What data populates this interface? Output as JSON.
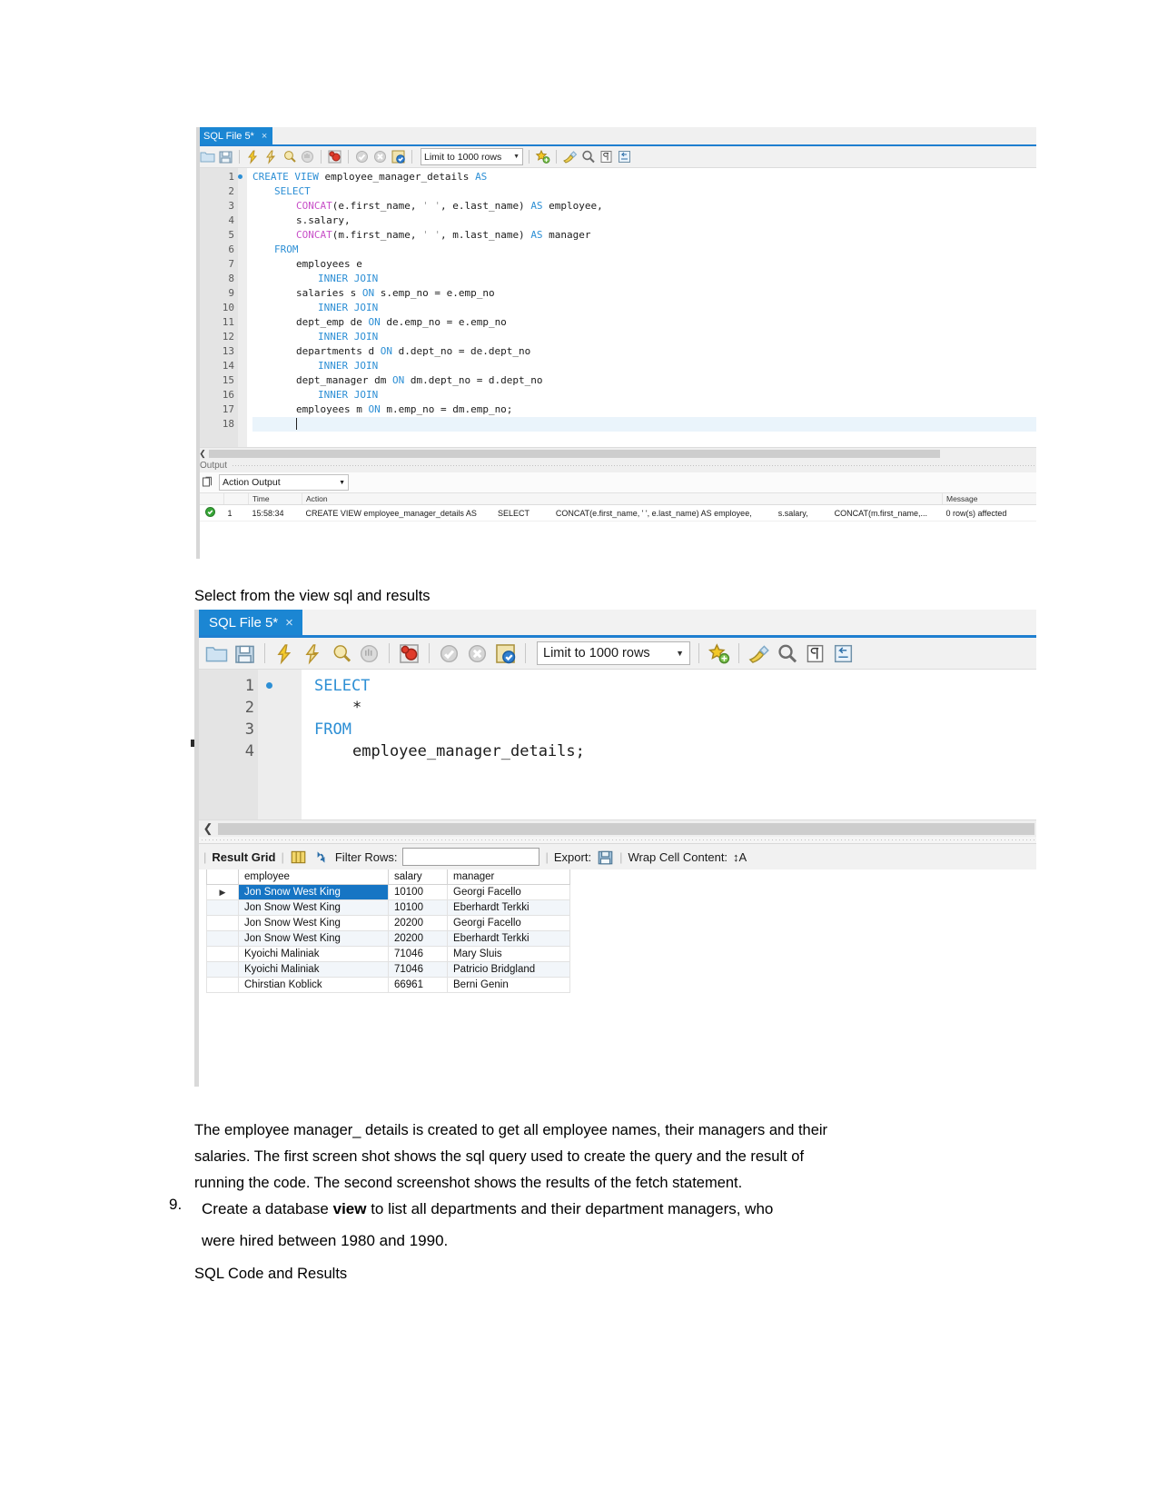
{
  "screenshot1": {
    "tab": {
      "label": "SQL File 5*",
      "close": "×"
    },
    "toolbar": {
      "limit_label": "Limit to 1000 rows",
      "icons": [
        "open-folder-icon",
        "save-icon",
        "execute-lightning-icon",
        "execute-current-lightning-icon",
        "explain-magnifier-icon",
        "stop-hand-icon",
        "toggle-breakpoint-icon",
        "commit-check-icon",
        "rollback-cancel-icon",
        "autocommit-icon",
        "star-bookmark-icon",
        "beautify-brush-icon",
        "find-magnifier-icon",
        "toggle-invisible-icon",
        "wrap-arrow-icon"
      ]
    },
    "editor": {
      "lines": [
        {
          "n": "1",
          "segments": [
            {
              "t": "CREATE VIEW ",
              "c": "kw"
            },
            {
              "t": "employee_manager_details ",
              "c": ""
            },
            {
              "t": "AS",
              "c": "kw"
            }
          ],
          "indent": 0,
          "marker": true
        },
        {
          "n": "2",
          "segments": [
            {
              "t": "SELECT",
              "c": "kw"
            }
          ],
          "indent": 1,
          "marker": false
        },
        {
          "n": "3",
          "segments": [
            {
              "t": "CONCAT",
              "c": "fn"
            },
            {
              "t": "(e.first_name, ",
              "c": ""
            },
            {
              "t": "' '",
              "c": "str"
            },
            {
              "t": ", e.last_name) ",
              "c": ""
            },
            {
              "t": "AS",
              "c": "kw"
            },
            {
              "t": " employee,",
              "c": ""
            }
          ],
          "indent": 2,
          "marker": false
        },
        {
          "n": "4",
          "segments": [
            {
              "t": "s.salary,",
              "c": ""
            }
          ],
          "indent": 2,
          "marker": false
        },
        {
          "n": "5",
          "segments": [
            {
              "t": "CONCAT",
              "c": "fn"
            },
            {
              "t": "(m.first_name, ",
              "c": ""
            },
            {
              "t": "' '",
              "c": "str"
            },
            {
              "t": ", m.last_name) ",
              "c": ""
            },
            {
              "t": "AS",
              "c": "kw"
            },
            {
              "t": " manager",
              "c": ""
            }
          ],
          "indent": 2,
          "marker": false
        },
        {
          "n": "6",
          "segments": [
            {
              "t": "FROM",
              "c": "kw"
            }
          ],
          "indent": 1,
          "marker": false
        },
        {
          "n": "7",
          "segments": [
            {
              "t": "employees e",
              "c": ""
            }
          ],
          "indent": 2,
          "marker": false
        },
        {
          "n": "8",
          "segments": [
            {
              "t": "INNER JOIN",
              "c": "kw"
            }
          ],
          "indent": 3,
          "marker": false
        },
        {
          "n": "9",
          "segments": [
            {
              "t": "salaries s ",
              "c": ""
            },
            {
              "t": "ON",
              "c": "kw"
            },
            {
              "t": " s.emp_no = e.emp_no",
              "c": ""
            }
          ],
          "indent": 2,
          "marker": false
        },
        {
          "n": "10",
          "segments": [
            {
              "t": "INNER JOIN",
              "c": "kw"
            }
          ],
          "indent": 3,
          "marker": false
        },
        {
          "n": "11",
          "segments": [
            {
              "t": "dept_emp de ",
              "c": ""
            },
            {
              "t": "ON",
              "c": "kw"
            },
            {
              "t": " de.emp_no = e.emp_no",
              "c": ""
            }
          ],
          "indent": 2,
          "marker": false
        },
        {
          "n": "12",
          "segments": [
            {
              "t": "INNER JOIN",
              "c": "kw"
            }
          ],
          "indent": 3,
          "marker": false
        },
        {
          "n": "13",
          "segments": [
            {
              "t": "departments d ",
              "c": ""
            },
            {
              "t": "ON",
              "c": "kw"
            },
            {
              "t": " d.dept_no = de.dept_no",
              "c": ""
            }
          ],
          "indent": 2,
          "marker": false
        },
        {
          "n": "14",
          "segments": [
            {
              "t": "INNER JOIN",
              "c": "kw"
            }
          ],
          "indent": 3,
          "marker": false
        },
        {
          "n": "15",
          "segments": [
            {
              "t": "dept_manager dm ",
              "c": ""
            },
            {
              "t": "ON",
              "c": "kw"
            },
            {
              "t": " dm.dept_no = d.dept_no",
              "c": ""
            }
          ],
          "indent": 2,
          "marker": false
        },
        {
          "n": "16",
          "segments": [
            {
              "t": "INNER JOIN",
              "c": "kw"
            }
          ],
          "indent": 3,
          "marker": false
        },
        {
          "n": "17",
          "segments": [
            {
              "t": "employees m ",
              "c": ""
            },
            {
              "t": "ON",
              "c": "kw"
            },
            {
              "t": " m.emp_no = dm.emp_no;",
              "c": ""
            }
          ],
          "indent": 2,
          "marker": false
        },
        {
          "n": "18",
          "segments": [],
          "indent": 2,
          "marker": false
        }
      ]
    },
    "output": {
      "panel_title": "Output",
      "selector_value": "Action Output",
      "columns": [
        "",
        "",
        "Time",
        "Action",
        "",
        "",
        "Message"
      ],
      "rows": [
        {
          "status": "success",
          "num": "1",
          "time": "15:58:34",
          "action": "CREATE VIEW employee_manager_details AS",
          "action2": "SELECT",
          "action3": "CONCAT(e.first_name, ' ', e.last_name) AS employee,",
          "action4": "s.salary,",
          "action5": "CONCAT(m.first_name,...",
          "message": "0 row(s) affected"
        }
      ]
    }
  },
  "caption": {
    "text": "Select from the view sql and results"
  },
  "screenshot2": {
    "tab": {
      "label": "SQL File 5*",
      "close": "×"
    },
    "toolbar": {
      "limit_label": "Limit to 1000 rows"
    },
    "editor": {
      "lines": [
        {
          "n": "1",
          "segments": [
            {
              "t": "SELECT",
              "c": "kw"
            }
          ],
          "indent": 0,
          "marker": true
        },
        {
          "n": "2",
          "segments": [
            {
              "t": "*",
              "c": ""
            }
          ],
          "indent": 1,
          "marker": false
        },
        {
          "n": "3",
          "segments": [
            {
              "t": "FROM",
              "c": "kw"
            }
          ],
          "indent": 0,
          "marker": false
        },
        {
          "n": "4",
          "segments": [
            {
              "t": "employee_manager_details;",
              "c": ""
            }
          ],
          "indent": 1,
          "marker": false
        }
      ]
    },
    "result_grid": {
      "label": "Result Grid",
      "filter_label": "Filter Rows:",
      "filter_value": "",
      "export_label": "Export:",
      "wrap_label": "Wrap Cell Content:",
      "wrap_icon_text": "↕A",
      "columns": [
        "employee",
        "salary",
        "manager"
      ],
      "rows": [
        {
          "employee": "Jon Snow West  King",
          "salary": "10100",
          "manager": "Georgi Facello",
          "selected": true,
          "marker": "▶"
        },
        {
          "employee": "Jon Snow West  King",
          "salary": "10100",
          "manager": "Eberhardt Terkki",
          "selected": false,
          "marker": ""
        },
        {
          "employee": "Jon Snow West  King",
          "salary": "20200",
          "manager": "Georgi Facello",
          "selected": false,
          "marker": ""
        },
        {
          "employee": "Jon Snow West  King",
          "salary": "20200",
          "manager": "Eberhardt Terkki",
          "selected": false,
          "marker": ""
        },
        {
          "employee": "Kyoichi Maliniak",
          "salary": "71046",
          "manager": "Mary Sluis",
          "selected": false,
          "marker": ""
        },
        {
          "employee": "Kyoichi Maliniak",
          "salary": "71046",
          "manager": "Patricio Bridgland",
          "selected": false,
          "marker": ""
        },
        {
          "employee": "Chirstian Koblick",
          "salary": "66961",
          "manager": "Berni Genin",
          "selected": false,
          "marker": ""
        }
      ]
    }
  },
  "body_text": {
    "paragraph_line1": "The employee manager_ details is created to get all employee names, their managers and their",
    "paragraph_line2": "salaries. The first screen shot shows the sql query used to create the query and the result of",
    "paragraph_line3": "running the code. The second screenshot shows the results of the fetch statement.",
    "list_number": "9.",
    "list_line1_a": "Create  a  database  ",
    "list_line1_b": "view",
    "list_line1_c": "  to  list  all  departments  and  their  department  managers,  who",
    "list_line2": "were hired between 1980 and 1990.",
    "subheading": "SQL Code and Results"
  },
  "colors": {
    "tab_blue": "#1b86d3",
    "accent_blue": "#2d8fd5",
    "grid_selection": "#1675c4",
    "keyword": "#2d8fd5",
    "function": "#c850c8",
    "string": "#9a9a9a"
  }
}
